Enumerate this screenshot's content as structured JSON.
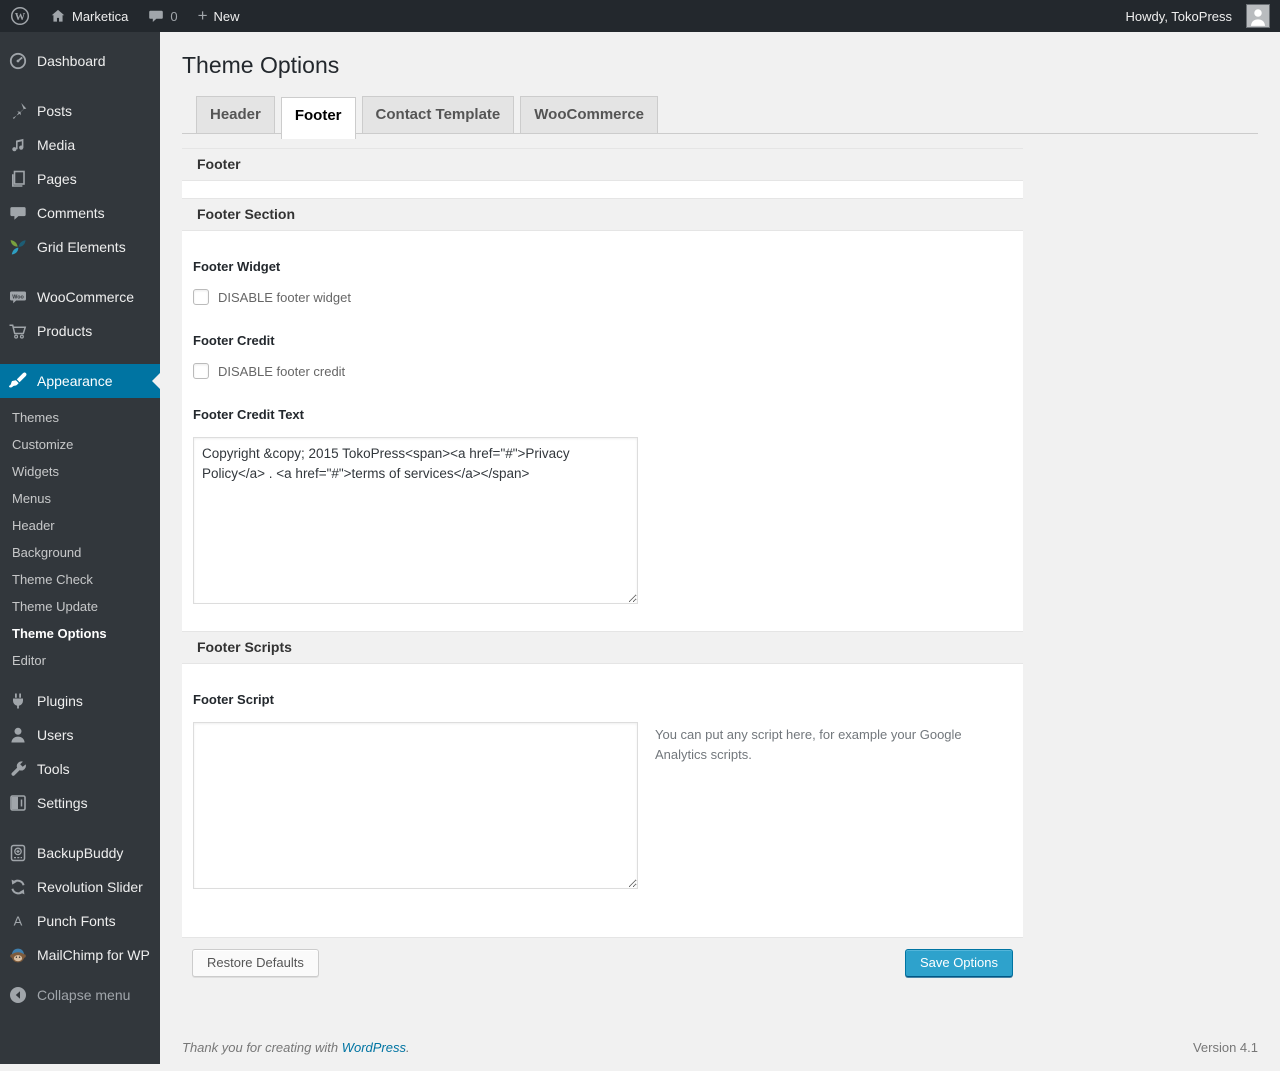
{
  "admin_bar": {
    "site_name": "Marketica",
    "comment_count": "0",
    "new_label": "New",
    "howdy_label": "Howdy, TokoPress"
  },
  "sidebar": {
    "menu": [
      {
        "label": "Dashboard",
        "icon": "dashboard-icon"
      },
      {
        "label": "Posts",
        "icon": "pushpin-icon"
      },
      {
        "label": "Media",
        "icon": "media-icon"
      },
      {
        "label": "Pages",
        "icon": "pages-icon"
      },
      {
        "label": "Comments",
        "icon": "comments-icon"
      },
      {
        "label": "Grid Elements",
        "icon": "grid-elements-icon"
      },
      {
        "label": "WooCommerce",
        "icon": "woocommerce-icon"
      },
      {
        "label": "Products",
        "icon": "cart-icon"
      },
      {
        "label": "Appearance",
        "icon": "appearance-brush-icon",
        "active": true
      },
      {
        "label": "Plugins",
        "icon": "plugin-icon"
      },
      {
        "label": "Users",
        "icon": "user-icon"
      },
      {
        "label": "Tools",
        "icon": "wrench-icon"
      },
      {
        "label": "Settings",
        "icon": "settings-icon"
      },
      {
        "label": "BackupBuddy",
        "icon": "backupbuddy-icon"
      },
      {
        "label": "Revolution Slider",
        "icon": "revolution-slider-icon"
      },
      {
        "label": "Punch Fonts",
        "icon": "punch-fonts-icon"
      },
      {
        "label": "MailChimp for WP",
        "icon": "mailchimp-icon"
      },
      {
        "label": "Collapse menu",
        "icon": "collapse-icon"
      }
    ],
    "appearance_submenu": [
      "Themes",
      "Customize",
      "Widgets",
      "Menus",
      "Header",
      "Background",
      "Theme Check",
      "Theme Update",
      "Theme Options",
      "Editor"
    ],
    "current_submenu_item": "Theme Options"
  },
  "page": {
    "title": "Theme Options",
    "tabs": [
      {
        "label": "Header"
      },
      {
        "label": "Footer",
        "active": true
      },
      {
        "label": "Contact Template"
      },
      {
        "label": "WooCommerce"
      }
    ]
  },
  "panel": {
    "header_title": "Footer",
    "section_title": "Footer Section",
    "footer_widget_label": "Footer Widget",
    "footer_widget_checkbox": "DISABLE footer widget",
    "footer_widget_checked": false,
    "footer_credit_label": "Footer Credit",
    "footer_credit_checkbox": "DISABLE footer credit",
    "footer_credit_checked": false,
    "footer_credit_text_label": "Footer Credit Text",
    "footer_credit_text_value": "Copyright &copy; 2015 TokoPress<span><a href=\"#\">Privacy Policy</a> . <a href=\"#\">terms of services</a></span>",
    "scripts_section_title": "Footer Scripts",
    "footer_script_label": "Footer Script",
    "footer_script_value": "",
    "footer_script_description": "You can put any script here, for example your Google Analytics scripts.",
    "restore_button": "Restore Defaults",
    "save_button": "Save Options"
  },
  "footer": {
    "thanks_prefix": "Thank you for creating with ",
    "wordpress_link": "WordPress",
    "thanks_suffix": ".",
    "version": "Version 4.1"
  },
  "colors": {
    "accent_blue": "#0074a2",
    "button_primary": "#2ea2cc",
    "admin_bar_bg": "#23282d",
    "sidebar_bg": "#32373c",
    "page_bg": "#f1f1f1"
  }
}
